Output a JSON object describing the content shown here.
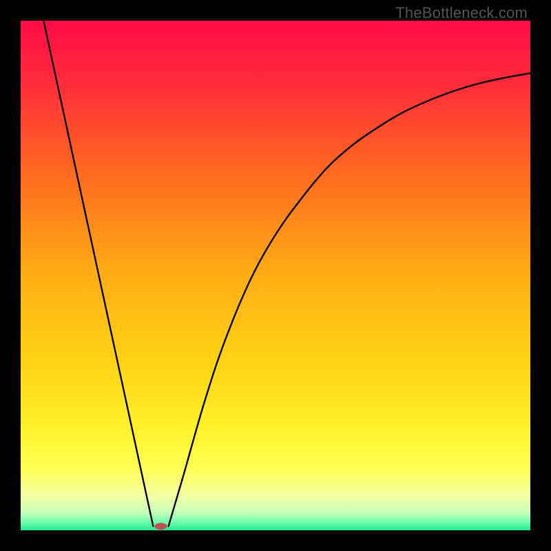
{
  "watermark": "TheBottleneck.com",
  "chart_data": {
    "type": "line",
    "title": "",
    "xlabel": "",
    "ylabel": "",
    "xlim": [
      0,
      100
    ],
    "ylim": [
      0,
      100
    ],
    "grid": false,
    "legend": false,
    "background_gradient": {
      "stops": [
        {
          "offset": 0.0,
          "color": "#ff0b47"
        },
        {
          "offset": 0.12,
          "color": "#ff2b3b"
        },
        {
          "offset": 0.3,
          "color": "#ff6a1f"
        },
        {
          "offset": 0.5,
          "color": "#ffad14"
        },
        {
          "offset": 0.68,
          "color": "#ffd514"
        },
        {
          "offset": 0.8,
          "color": "#fff22a"
        },
        {
          "offset": 0.88,
          "color": "#ffff55"
        },
        {
          "offset": 0.93,
          "color": "#f4ffa0"
        },
        {
          "offset": 0.965,
          "color": "#c8ffb8"
        },
        {
          "offset": 0.985,
          "color": "#6bffb0"
        },
        {
          "offset": 1.0,
          "color": "#20e88a"
        }
      ]
    },
    "series": [
      {
        "name": "left-branch",
        "x": [
          4.5,
          26.0
        ],
        "y": [
          100.0,
          0.8
        ]
      },
      {
        "name": "right-branch",
        "x": [
          29.0,
          32,
          36,
          40,
          45,
          50,
          55,
          60,
          65,
          70,
          75,
          80,
          85,
          90,
          95,
          100
        ],
        "y": [
          0.8,
          11,
          25,
          37,
          49,
          58,
          65,
          71,
          75.5,
          79,
          82,
          84.3,
          86.2,
          87.7,
          88.8,
          89.7
        ]
      }
    ],
    "marker": {
      "name": "min-point",
      "x": 27.5,
      "y": 0.8,
      "color": "#c05050",
      "rx": 9,
      "ry": 5
    }
  }
}
